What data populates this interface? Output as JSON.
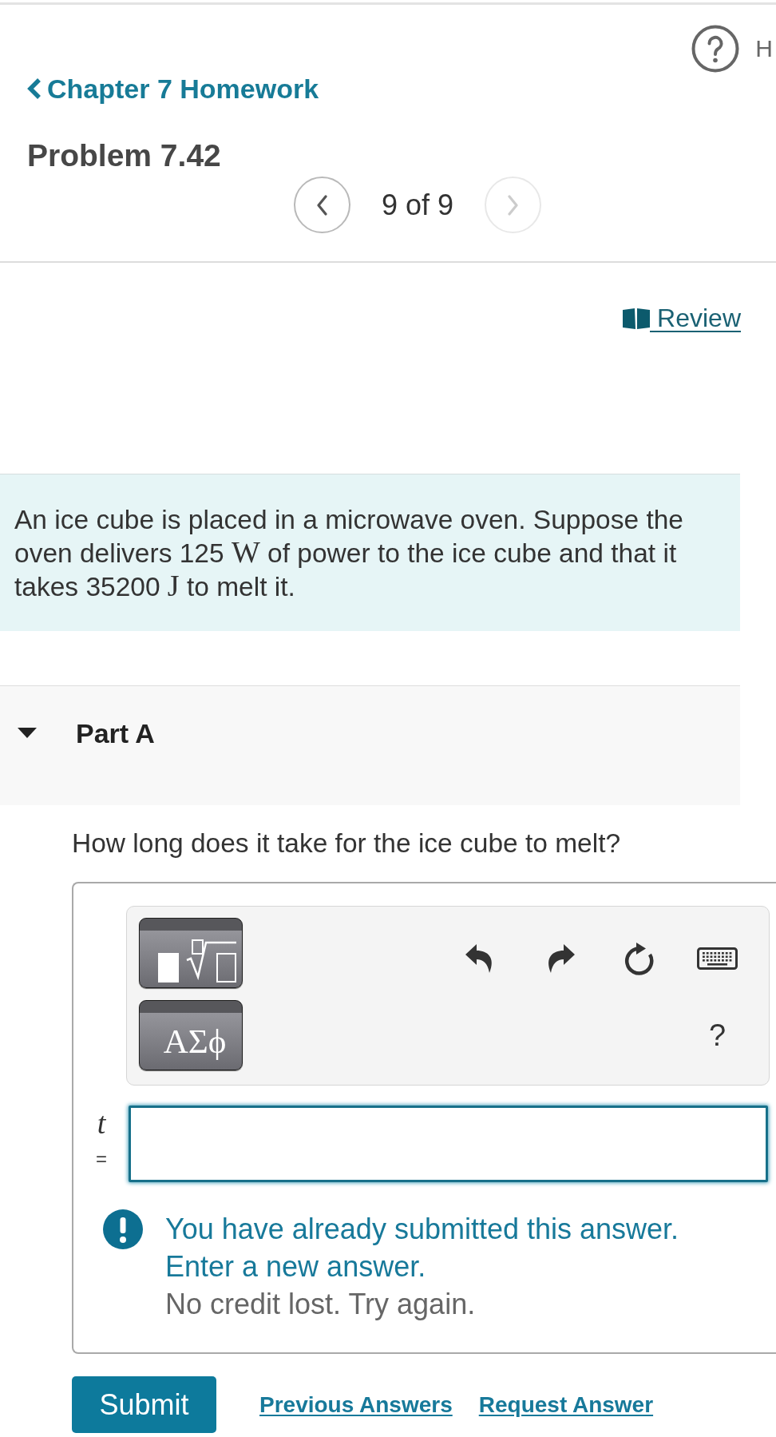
{
  "help_link": {
    "label": "H"
  },
  "back_link": {
    "label": "Chapter 7 Homework"
  },
  "problem": {
    "title": "Problem 7.42"
  },
  "pager": {
    "position": "9 of 9",
    "previous": {
      "disabled": false
    },
    "next": {
      "disabled": true
    }
  },
  "review_link": {
    "label": "Review"
  },
  "question": {
    "runs": [
      {
        "kind": "text",
        "text": "An ice cube is placed in a microwave oven. Suppose the oven delivers 125 "
      },
      {
        "kind": "math",
        "text": "W"
      },
      {
        "kind": "text",
        "text": " of power to the ice cube and that it takes 35200 "
      },
      {
        "kind": "math",
        "text": "J"
      },
      {
        "kind": "text",
        "text": " to melt it."
      }
    ]
  },
  "part": {
    "label": "Part A",
    "expanded": true,
    "prompt": "How long does it take for the ice cube to melt?",
    "toolbar": {
      "symbols_button": "ΑΣϕ",
      "help_button": "?"
    },
    "answer": {
      "variable": "t",
      "relation": "="
    },
    "feedback": {
      "kind": "warning",
      "message": "You have already submitted this answer. Enter a new answer.",
      "note": "No credit lost. Try again."
    },
    "actions": [
      {
        "kind": "primary",
        "label": "Submit"
      },
      {
        "kind": "link",
        "label": "Previous Answers"
      },
      {
        "kind": "link",
        "label": "Request Answer"
      }
    ]
  }
}
